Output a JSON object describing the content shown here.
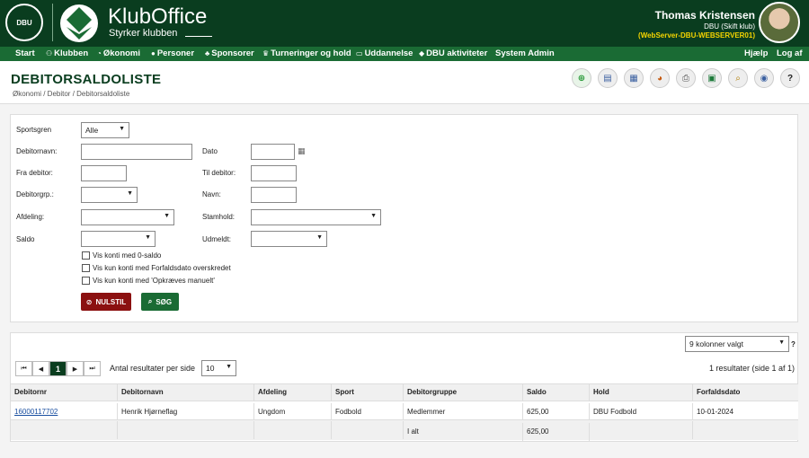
{
  "header": {
    "dbu_logo_text": "DBU",
    "brand": "KlubOffice",
    "tagline": "Styrker klubben",
    "user_name": "Thomas Kristensen",
    "user_club": "DBU (Skift klub)",
    "user_server": "(WebServer-DBU-WEBSERVER01)"
  },
  "nav": {
    "items": [
      "Start",
      "Klubben",
      "Økonomi",
      "Personer",
      "Sponsorer",
      "Turneringer og hold",
      "Uddannelse",
      "DBU aktiviteter",
      "System Admin"
    ],
    "help": "Hjælp",
    "logout": "Log af"
  },
  "page": {
    "title": "DEBITORSALDOLISTE",
    "breadcrumb": "Økonomi / Debitor / Debitorsaldoliste"
  },
  "filters": {
    "sportsgren_label": "Sportsgren",
    "sportsgren_value": "Alle",
    "debitornavn_label": "Debitornavn:",
    "dato_label": "Dato",
    "fra_debitor_label": "Fra debitor:",
    "til_debitor_label": "Til debitor:",
    "debitorgrp_label": "Debitorgrp.:",
    "navn_label": "Navn:",
    "afdeling_label": "Afdeling:",
    "stamhold_label": "Stamhold:",
    "saldo_label": "Saldo",
    "udmeldt_label": "Udmeldt:",
    "check_0_saldo": "Vis konti med 0-saldo",
    "check_forfald": "Vis kun konti med Forfaldsdato overskredet",
    "check_manuelt": "Vis kun konti med 'Opkræves manuelt'",
    "reset_label": "NULSTIL",
    "search_label": "SØG"
  },
  "results": {
    "columns_selected": "9 kolonner valgt",
    "help_mark": "?",
    "current_page": "1",
    "per_page_label": "Antal resultater per side",
    "per_page_value": "10",
    "summary": "1 resultater (side 1 af 1)",
    "headers": [
      "Debitornr",
      "Debitornavn",
      "Afdeling",
      "Sport",
      "Debitorgruppe",
      "Saldo",
      "Hold",
      "Forfaldsdato"
    ],
    "rows": [
      [
        "16000117702",
        "Henrik Hjørneflag",
        "Ungdom",
        "Fodbold",
        "Medlemmer",
        "625,00",
        "DBU Fodbold",
        "10-01-2024"
      ]
    ],
    "total_label": "I alt",
    "total_value": "625,00"
  }
}
